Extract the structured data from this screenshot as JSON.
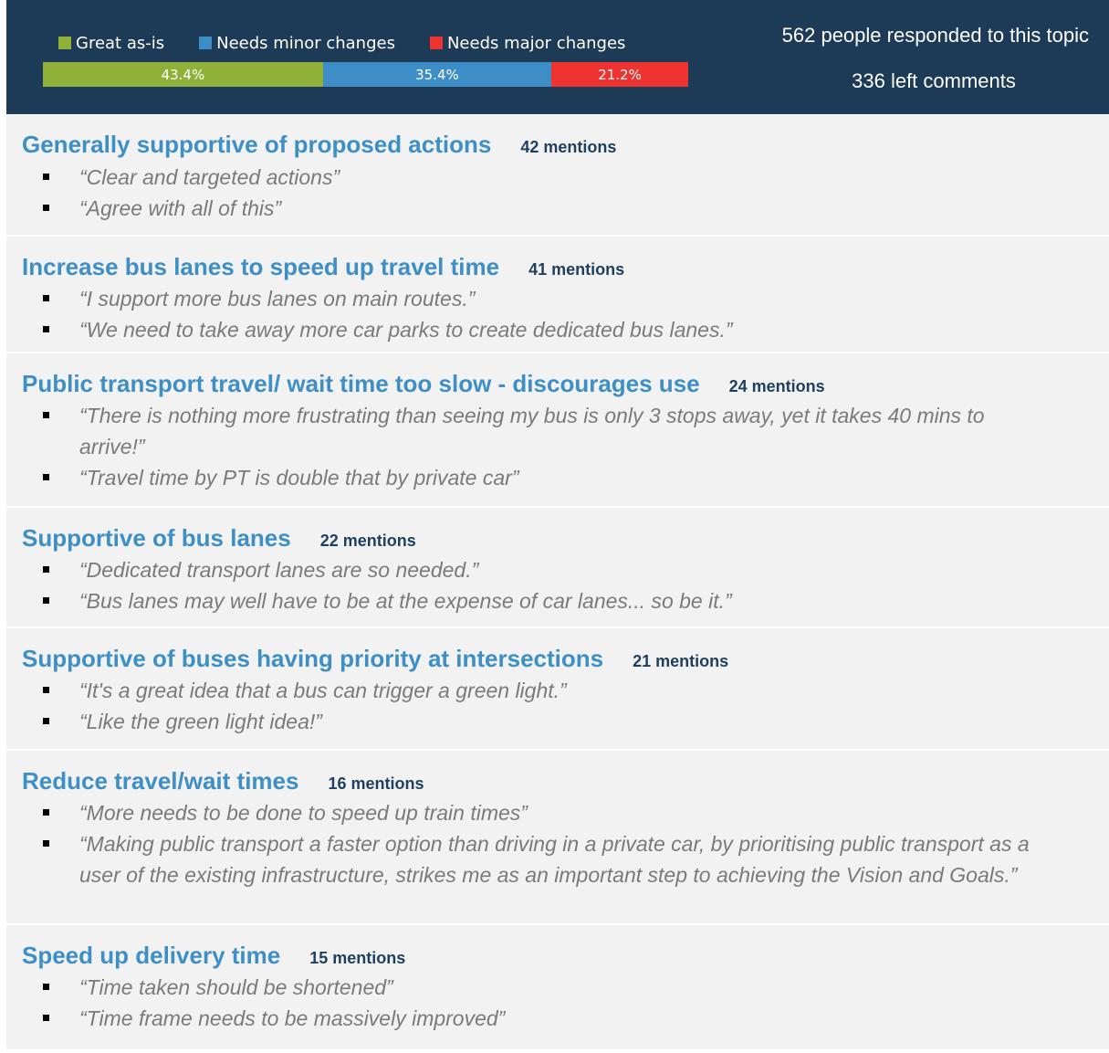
{
  "summary": {
    "legend": [
      {
        "label": "Great as-is",
        "color": "#8fb13a"
      },
      {
        "label": "Needs minor changes",
        "color": "#3d8ec6"
      },
      {
        "label": "Needs major changes",
        "color": "#ee3331"
      }
    ],
    "bar": [
      {
        "label": "43.4%",
        "value": 43.4,
        "color": "#8fb13a"
      },
      {
        "label": "35.4%",
        "value": 35.4,
        "color": "#3d8ec6"
      },
      {
        "label": "21.2%",
        "value": 21.2,
        "color": "#ee3331"
      }
    ],
    "responded": "562 people responded to this topic",
    "comments": "336 left comments"
  },
  "themes": [
    {
      "title": "Generally supportive of proposed actions",
      "mentions": "42 mentions",
      "quotes": [
        "“Clear and targeted actions”",
        "“Agree with all of this”"
      ]
    },
    {
      "title": "Increase bus lanes to speed up travel time",
      "mentions": "41 mentions",
      "quotes": [
        "“I support more bus lanes on main routes.”",
        "“We need to take away more car parks to create dedicated bus lanes.”"
      ]
    },
    {
      "title": "Public transport travel/ wait time too slow - discourages use",
      "mentions": "24 mentions",
      "quotes": [
        "“There is nothing more frustrating than seeing my bus is only 3 stops away, yet it takes 40 mins to arrive!”",
        "“Travel time by PT is double that by private car”"
      ]
    },
    {
      "title": "Supportive of bus lanes",
      "mentions": "22 mentions",
      "quotes": [
        "“Dedicated transport lanes are so needed.”",
        "“Bus lanes may well have to be at the expense of car lanes... so be it.”"
      ]
    },
    {
      "title": "Supportive of buses having priority at intersections",
      "mentions": "21 mentions",
      "quotes": [
        "“It's a great idea that a bus can trigger a green light.”",
        "“Like the green light idea!”"
      ]
    },
    {
      "title": "Reduce travel/wait times",
      "mentions": "16 mentions",
      "quotes": [
        "“More needs to be done to speed up train times”",
        "“Making public transport a faster option than driving in a private car, by prioritising public transport as a user of the existing infrastructure, strikes me as an important step to achieving the Vision and Goals.”"
      ]
    },
    {
      "title": "Speed up delivery time",
      "mentions": "15 mentions",
      "quotes": [
        "“Time taken should be shortened”",
        "“Time frame needs to be massively improved”"
      ]
    }
  ]
}
